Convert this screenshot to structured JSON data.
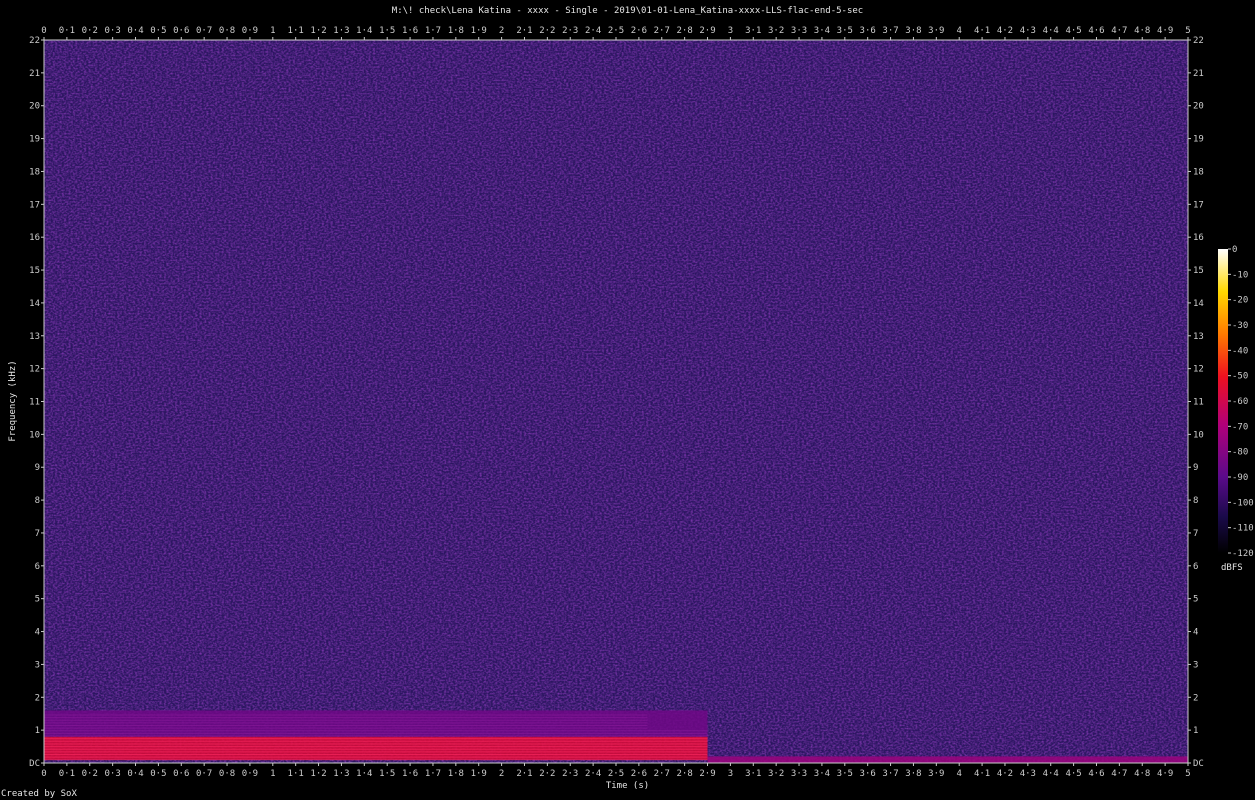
{
  "chart_data": {
    "type": "heatmap",
    "title": "M:\\! check\\Lena Katina - xxxx - Single - 2019\\01-01-Lena_Katina-xxxx-LLS-flac-end-5-sec",
    "xlabel": "Time (s)",
    "ylabel": "Frequency (kHz)",
    "xlim": [
      0,
      5
    ],
    "ylim": [
      0,
      22
    ],
    "x_ticks": [
      "0",
      "0·1",
      "0·2",
      "0·3",
      "0·4",
      "0·5",
      "0·6",
      "0·7",
      "0·8",
      "0·9",
      "1",
      "1·1",
      "1·2",
      "1·3",
      "1·4",
      "1·5",
      "1·6",
      "1·7",
      "1·8",
      "1·9",
      "2",
      "2·1",
      "2·2",
      "2·3",
      "2·4",
      "2·5",
      "2·6",
      "2·7",
      "2·8",
      "2·9",
      "3",
      "3·1",
      "3·2",
      "3·3",
      "3·4",
      "3·5",
      "3·6",
      "3·7",
      "3·8",
      "3·9",
      "4",
      "4·1",
      "4·2",
      "4·3",
      "4·4",
      "4·5",
      "4·6",
      "4·7",
      "4·8",
      "4·9",
      "5"
    ],
    "y_ticks": [
      "DC",
      "1",
      "2",
      "3",
      "4",
      "5",
      "6",
      "7",
      "8",
      "9",
      "10",
      "11",
      "12",
      "13",
      "14",
      "15",
      "16",
      "17",
      "18",
      "19",
      "20",
      "21",
      "22"
    ],
    "colorbar": {
      "label": "dBFS",
      "range": [
        -120,
        0
      ],
      "ticks": [
        "0",
        "-10",
        "-20",
        "-30",
        "-40",
        "-50",
        "-60",
        "-70",
        "-80",
        "-90",
        "-100",
        "-110",
        "-120"
      ]
    },
    "signal_regions": [
      {
        "t_start": 0,
        "t_end": 2.9,
        "f_low": 0.1,
        "f_high": 0.8,
        "level_dbfs": -55
      },
      {
        "t_start": 0,
        "t_end": 2.9,
        "f_low": 0.8,
        "f_high": 1.6,
        "level_dbfs": -85
      },
      {
        "t_start": 2.9,
        "t_end": 5,
        "f_low": 0,
        "f_high": 0.2,
        "level_dbfs": -75
      },
      {
        "t_start": 0,
        "t_end": 5,
        "f_low": 0,
        "f_high": 22,
        "level_dbfs": -105
      }
    ],
    "footer": "Created by SoX"
  },
  "colors": {
    "background": "#000000",
    "noise": "#2b1660",
    "signal": "#e0107a",
    "axis": "#cccccc"
  }
}
